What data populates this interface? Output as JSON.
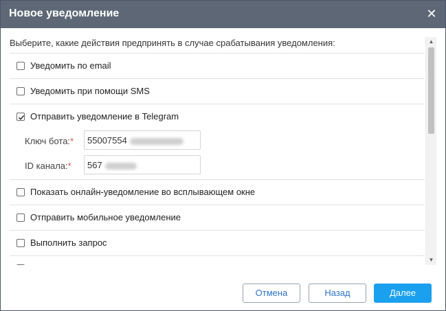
{
  "dialog": {
    "title": "Новое уведомление",
    "close_glyph": "✕"
  },
  "prompt": "Выберите, какие действия предпринять в случае срабатывания уведомления:",
  "actions": [
    {
      "label": "Уведомить по email",
      "checked": false
    },
    {
      "label": "Уведомить при помощи SMS",
      "checked": false
    },
    {
      "label": "Отправить уведомление в Telegram",
      "checked": true
    },
    {
      "label": "Показать онлайн-уведомление во всплывающем окне",
      "checked": false
    },
    {
      "label": "Отправить мобильное уведомление",
      "checked": false
    },
    {
      "label": "Выполнить запрос",
      "checked": false
    }
  ],
  "telegram": {
    "bot_key_label": "Ключ бота:",
    "bot_key_value": "55007554",
    "channel_id_label": "ID канала:",
    "channel_id_value": "567",
    "required_mark": "*"
  },
  "buttons": {
    "cancel": "Отмена",
    "back": "Назад",
    "next": "Далее"
  },
  "colors": {
    "titlebar": "#5d6776",
    "accent": "#1aa0ee",
    "link_text": "#2b73c8",
    "required": "#d9534f"
  }
}
